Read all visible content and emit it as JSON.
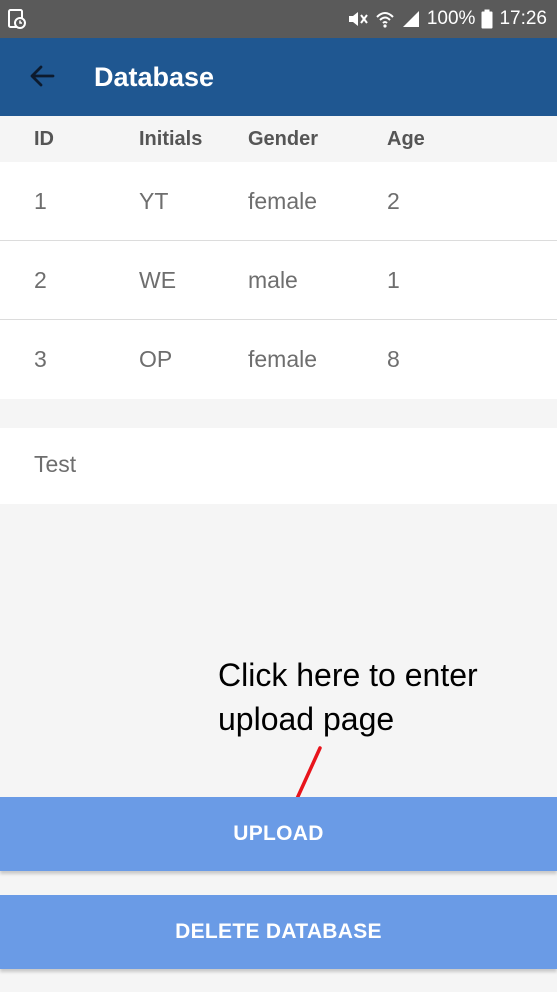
{
  "status_bar": {
    "battery": "100%",
    "time": "17:26",
    "icons": [
      "screenshot-icon",
      "mute-icon",
      "wifi-icon",
      "signal-icon",
      "battery-icon"
    ]
  },
  "app_bar": {
    "title": "Database",
    "back_icon": "arrow-back-icon"
  },
  "table": {
    "columns": [
      "ID",
      "Initials",
      "Gender",
      "Age"
    ],
    "rows": [
      [
        "1",
        "YT",
        "female",
        "2"
      ],
      [
        "2",
        "WE",
        "male",
        "1"
      ],
      [
        "3",
        "OP",
        "female",
        "8"
      ]
    ]
  },
  "test_field": {
    "text": "Test"
  },
  "annotation": {
    "text": "Click here to enter\nupload page",
    "arrow_color": "#e8141b"
  },
  "buttons": {
    "upload": "UPLOAD",
    "delete": "DELETE DATABASE"
  },
  "colors": {
    "app_bar": "#1f5791",
    "status_bar": "#5a5a5a",
    "button": "#6a9be6",
    "background": "#f5f5f5"
  }
}
